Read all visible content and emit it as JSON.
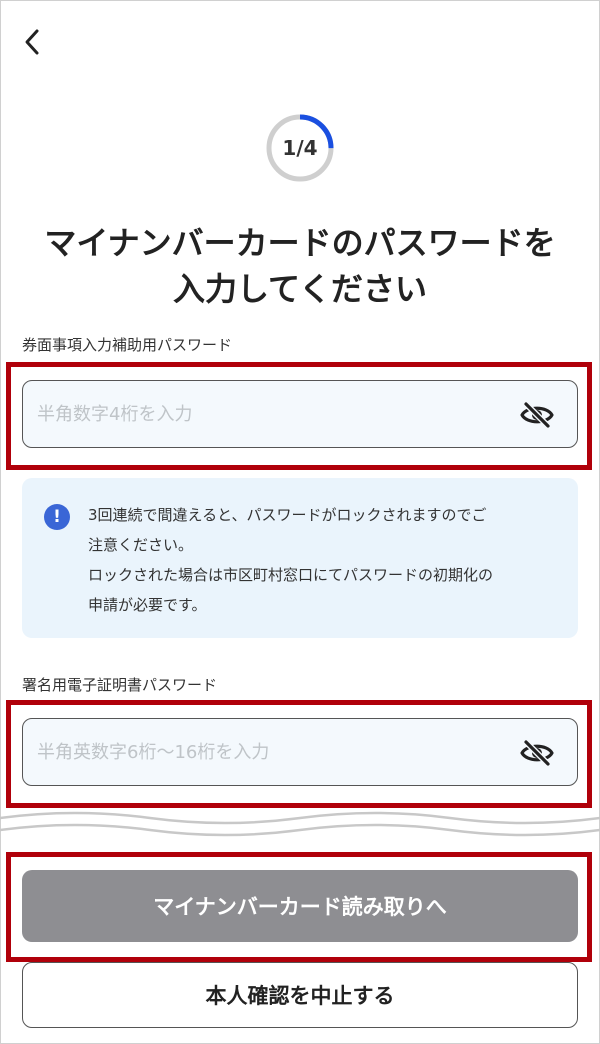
{
  "header": {
    "back_icon": "chevron-left-icon"
  },
  "progress": {
    "label": "1/4",
    "value": 0.25,
    "color_active": "#1a4fe0",
    "color_track": "#cfcfcf"
  },
  "title": {
    "line1": "マイナンバーカードのパスワードを",
    "line2": "入力してください"
  },
  "field1": {
    "label": "券面事項入力補助用パスワード",
    "placeholder": "半角数字4桁を入力",
    "value": "",
    "icon": "eye-slash-icon"
  },
  "notice": {
    "icon": "exclamation-circle-icon",
    "line1": "3回連続で間違えると、パスワードがロックされますのでご",
    "line2": "注意ください。",
    "line3": "ロックされた場合は市区町村窓口にてパスワードの初期化の",
    "line4": "申請が必要です。"
  },
  "field2": {
    "label": "署名用電子証明書パスワード",
    "placeholder": "半角英数字6桁〜16桁を入力",
    "value": "",
    "icon": "eye-slash-icon"
  },
  "buttons": {
    "primary": "マイナンバーカード読み取りへ",
    "secondary": "本人確認を中止する"
  },
  "colors": {
    "highlight": "#b0000a",
    "primary_button": "#8e8e92",
    "notice_bg": "#eaf4fc",
    "input_bg": "#f4f9fd"
  }
}
